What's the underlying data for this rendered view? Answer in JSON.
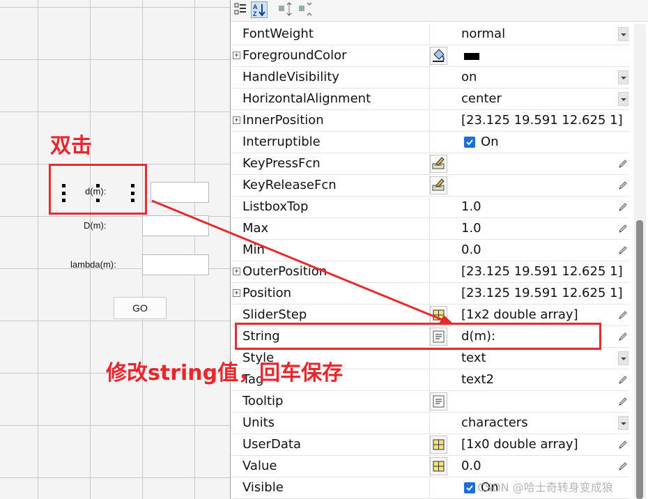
{
  "guide": {
    "labels": {
      "d": "d(m):",
      "D": "D(m):",
      "lambda": "lambda(m):"
    },
    "go_button": "GO"
  },
  "annotations": {
    "double_click": "双击",
    "edit_hint": "修改string值，回车保存"
  },
  "inspector": {
    "toolbar": [
      "categorize-icon",
      "sort-alpha-icon",
      "expand-all-icon",
      "collapse-all-icon"
    ],
    "rows": [
      {
        "name": "FontWeight",
        "value": "normal",
        "expandable": false,
        "editor": "dropdown"
      },
      {
        "name": "ForegroundColor",
        "value": "",
        "expandable": true,
        "editor": "none",
        "icon": "paint-bucket-icon",
        "swatch": "#000000"
      },
      {
        "name": "HandleVisibility",
        "value": "on",
        "expandable": false,
        "editor": "dropdown"
      },
      {
        "name": "HorizontalAlignment",
        "value": "center",
        "expandable": false,
        "editor": "dropdown"
      },
      {
        "name": "InnerPosition",
        "value": "[23.125 19.591 12.625 1]",
        "expandable": true,
        "editor": "none"
      },
      {
        "name": "Interruptible",
        "value": "On",
        "expandable": false,
        "editor": "none",
        "checkbox": true
      },
      {
        "name": "KeyPressFcn",
        "value": "",
        "expandable": false,
        "editor": "pencil",
        "icon": "callback-icon"
      },
      {
        "name": "KeyReleaseFcn",
        "value": "",
        "expandable": false,
        "editor": "pencil",
        "icon": "callback-icon"
      },
      {
        "name": "ListboxTop",
        "value": "1.0",
        "expandable": false,
        "editor": "pencil"
      },
      {
        "name": "Max",
        "value": "1.0",
        "expandable": false,
        "editor": "pencil"
      },
      {
        "name": "Min",
        "value": "0.0",
        "expandable": false,
        "editor": "pencil"
      },
      {
        "name": "OuterPosition",
        "value": "[23.125 19.591 12.625 1]",
        "expandable": true,
        "editor": "none"
      },
      {
        "name": "Position",
        "value": "[23.125 19.591 12.625 1]",
        "expandable": true,
        "editor": "none"
      },
      {
        "name": "SliderStep",
        "value": "[1x2  double array]",
        "expandable": false,
        "editor": "pencil",
        "icon": "array-icon"
      },
      {
        "name": "String",
        "value": "d(m):",
        "expandable": false,
        "editor": "pencil",
        "icon": "text-edit-icon"
      },
      {
        "name": "Style",
        "value": "text",
        "expandable": false,
        "editor": "dropdown"
      },
      {
        "name": "Tag",
        "value": "text2",
        "expandable": false,
        "editor": "pencil"
      },
      {
        "name": "Tooltip",
        "value": "",
        "expandable": false,
        "editor": "pencil",
        "icon": "text-edit-icon"
      },
      {
        "name": "Units",
        "value": "characters",
        "expandable": false,
        "editor": "dropdown"
      },
      {
        "name": "UserData",
        "value": "[1x0  double array]",
        "expandable": false,
        "editor": "pencil",
        "icon": "array-icon"
      },
      {
        "name": "Value",
        "value": "0.0",
        "expandable": false,
        "editor": "pencil",
        "icon": "array-icon"
      },
      {
        "name": "Visible",
        "value": "On",
        "expandable": false,
        "editor": "none",
        "checkbox": true
      }
    ]
  },
  "watermark": "CSDN @哈士奇转身变成狼",
  "colors": {
    "annotation_red": "#e52b2f",
    "checkbox_blue": "#1d6fd8"
  }
}
